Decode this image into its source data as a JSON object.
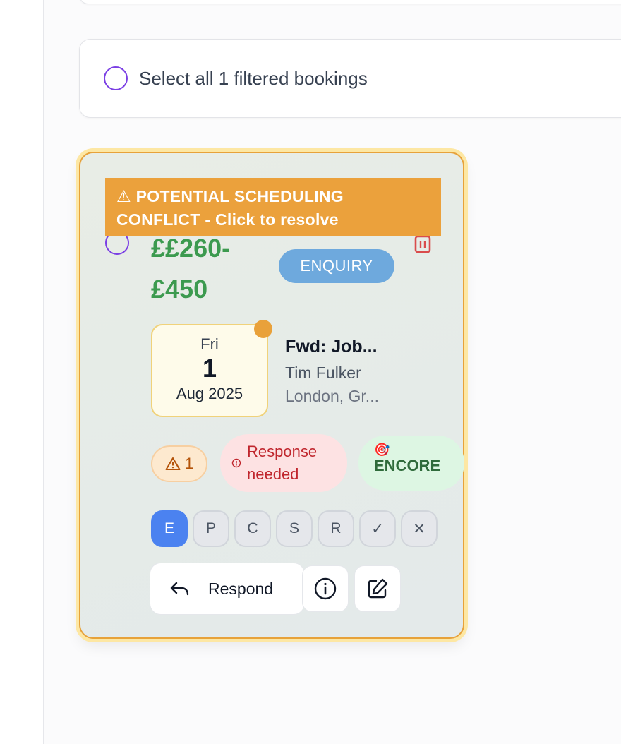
{
  "select_all": {
    "label": "Select all 1 filtered bookings"
  },
  "booking": {
    "conflict_banner": "⚠ POTENTIAL SCHEDULING CONFLICT - Click to resolve",
    "price": "££260-£450",
    "status": "ENQUIRY",
    "date": {
      "weekday": "Fri",
      "day": "1",
      "month_year": "Aug 2025"
    },
    "title": "Fwd: Job...",
    "client": "Tim Fulker",
    "venue": "London, Gr...",
    "badges": {
      "conflict_count": "1",
      "response_needed": "Response needed",
      "encore_emoji": "🎯",
      "encore": "ENCORE"
    },
    "stages": [
      {
        "label": "E",
        "active": true
      },
      {
        "label": "P",
        "active": false
      },
      {
        "label": "C",
        "active": false
      },
      {
        "label": "S",
        "active": false
      },
      {
        "label": "R",
        "active": false
      },
      {
        "label": "✓",
        "active": false
      },
      {
        "label": "✕",
        "active": false
      }
    ],
    "actions": {
      "respond_label": "Respond"
    }
  },
  "colors": {
    "accent_purple": "#7b3fe4",
    "conflict_orange": "#eba13c",
    "price_green": "#3c9a4f",
    "enquiry_blue": "#6ea9dd",
    "active_stage_blue": "#4b82f0",
    "delete_red": "#d94c4c"
  }
}
